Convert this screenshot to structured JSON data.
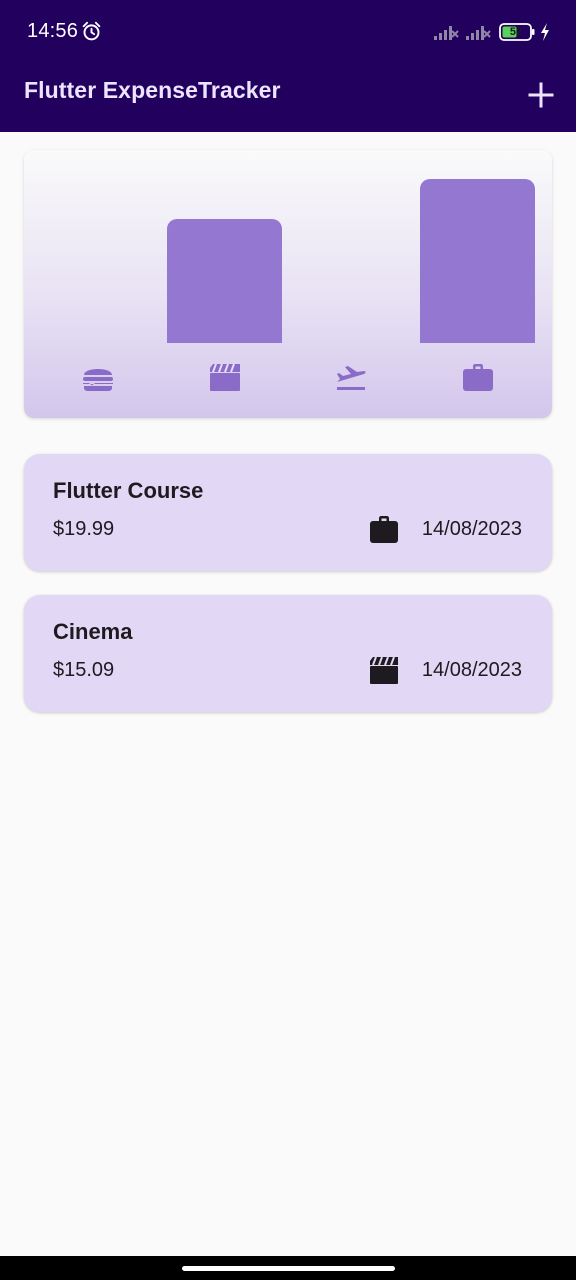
{
  "status_bar": {
    "time": "14:56",
    "battery": "52",
    "icons": [
      "alarm-icon",
      "signal-icon",
      "signal-icon",
      "battery-icon",
      "charging-bolt-icon"
    ]
  },
  "app_bar": {
    "title": "Flutter ExpenseTracker",
    "add_icon": "plus-icon"
  },
  "chart": {
    "categories": [
      "food",
      "leisure",
      "travel",
      "work"
    ],
    "category_icons": [
      "burger-icon",
      "clapperboard-icon",
      "flight-takeoff-icon",
      "briefcase-icon"
    ],
    "values": [
      0,
      15.09,
      0,
      19.99
    ],
    "bar_color": "#9377d0"
  },
  "expenses": [
    {
      "title": "Flutter Course",
      "amount": "$19.99",
      "category_icon": "briefcase-icon",
      "date": "14/08/2023"
    },
    {
      "title": "Cinema",
      "amount": "$15.09",
      "category_icon": "clapperboard-icon",
      "date": "14/08/2023"
    }
  ],
  "colors": {
    "app_bar": "#22005e",
    "card": "#e2d7f4",
    "chart_bar": "#9377d0",
    "background": "#fafafa"
  }
}
